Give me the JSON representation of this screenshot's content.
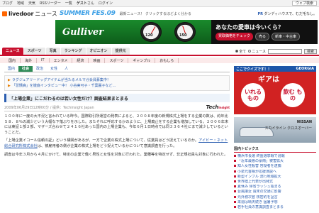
{
  "topbar": {
    "links": [
      "ブログ",
      "地域",
      "天気",
      "RSSリーダー",
      "一覧"
    ],
    "user_name": "ゲスト",
    "user_suffix": "さん",
    "login": "ログイン",
    "web_search": "ウェブ検索"
  },
  "header": {
    "logo": "livedoor",
    "logo_news": "ニュース",
    "summer": "SUMMER FES.09",
    "tagline": "最新ニュース！ クリックするほどよく分かる",
    "ad_prefix": "PR",
    "ad_link": "ダンディハウスで、むだ毛なし。"
  },
  "banner": {
    "brand": "Gulliver",
    "gauge_nums": [
      "120",
      "150"
    ],
    "question": "あなたの愛車は今いくら？",
    "pills": [
      "買取価格をチェック",
      "売る",
      "新車・中古車"
    ]
  },
  "nav": {
    "items": [
      "ニュース",
      "スポーツ",
      "写真",
      "ランキング",
      "オピニオン",
      "提供元"
    ],
    "active": 0,
    "search_radio_all": "全て",
    "search_radio_news": "ニュース",
    "search_button": "検索"
  },
  "subnav": {
    "items": [
      "国内",
      "海外",
      "IT",
      "エンタメ",
      "経済",
      "映画",
      "スポーツ",
      "ギャンブル",
      "おもしろ"
    ]
  },
  "article": {
    "cat_tabs": [
      "国内",
      "社会",
      "政治",
      "女性",
      "人"
    ],
    "cat_active": 1,
    "promos": [
      "ラグジュアリードッグアイテムが当たるメルマガ会員募集中！",
      "「習慣病」を徹底インタビュー中！ 小谷実可子・千葉麗子など…"
    ],
    "headline": "「上場企業」にこだわるのは若い女性だけ？調査結果まとまる",
    "date": "2009年06月29日12時00分 / 提供：Techinsight Japan",
    "source_logo": "Tech",
    "source_logo_small": "insight",
    "para1": "１００年に一度の大不況と言われている昨今。国際取引所運営の発表によると、２００８年度の新規株式上場をする企業の数は、約年比５８．８％の減少という大幅な下落ぶりを示した。またそれに呼応するかのように、上場廃止をする企業も増加している。２００６年末には東証１部２部、マザーズ合わせて２４１６社あった国内の上場企業も、今年６月１日時点では同３３６４社にまで減少しているということだ。",
    "para2_a": "「上場企業イコール信頼の証」という構図があるが、一方で企業の株式上場について、従業員はどう捉えているのか。",
    "para2_link": "アイビー・ネット総合研究所株式会社",
    "para2_b": "は、被雇用者の側が企業の株式上場をどう捉えているかについて意識調査を行った。",
    "para3": "調査は今年３月から４月にかけて、特定の企業で働く男性と女性を対象に行われた。業種等を特定せず、非正規社員も対象に行われた。"
  },
  "right": {
    "quiz_title": "ここでクイズです！！",
    "quiz_brand": "GEORGIA",
    "georgia_title": "ギアは",
    "circle_left": "いれる もの",
    "circle_right": "飲む もの",
    "nissan_brand": "NISSAN",
    "nissan_model": "スカイライン クロスオーバー",
    "side_title": "国内トピックス",
    "side_items": [
      "横浜市長選 終盤選挙戦で混戦",
      "「近年最悪の豪雨」被害拡大",
      "知人女性殺害 容疑者を逮捕",
      "小泉元首相が応援演説へ",
      "新型インフル 流行地域拡大",
      "世界陸上代表が出発式",
      "夏休み 帰省ラッシュ始まる",
      "台風接近 週末の交通に影響",
      "元外務次官 核密約を証言",
      "来週は晴天続き 猛暑予想",
      "若手社員の意識調査まとまる"
    ]
  }
}
